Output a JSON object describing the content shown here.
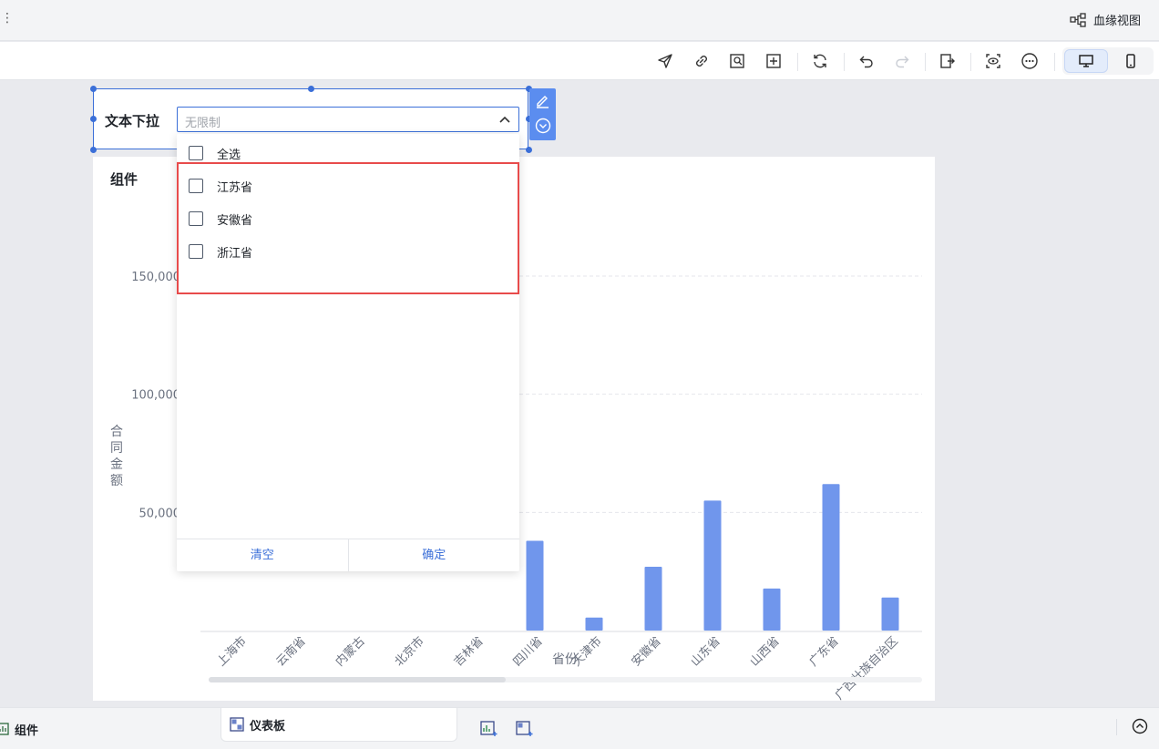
{
  "topbar": {
    "menu_glyph": "⋮",
    "lineage_label": "血缘视图"
  },
  "toolbar": {
    "icons": [
      "send-icon",
      "link-icon",
      "image-search-icon",
      "grid-plus-icon",
      "refresh-icon",
      "undo-icon",
      "redo-icon",
      "exit-icon",
      "preview-icon",
      "more-icon"
    ],
    "device": [
      "desktop-icon",
      "mobile-icon"
    ]
  },
  "filter": {
    "label": "文本下拉",
    "placeholder": "无限制",
    "options": [
      "全选",
      "江苏省",
      "安徽省",
      "浙江省"
    ],
    "clear_label": "清空",
    "confirm_label": "确定"
  },
  "chart": {
    "title": "组件",
    "y_tick_labels": [
      "150,000",
      "100,000",
      "50,000"
    ],
    "visible_bar_tick_labels": [
      "上海市",
      "云南省",
      "内蒙古",
      "北京市",
      "吉林省"
    ]
  },
  "chart_data": {
    "type": "bar",
    "title": "组件",
    "xlabel": "省份",
    "ylabel": "合同金额",
    "ylim": [
      0,
      150000
    ],
    "y_ticks": [
      0,
      50000,
      100000,
      150000
    ],
    "grid": true,
    "categories": [
      "上海市",
      "云南省",
      "内蒙古",
      "北京市",
      "吉林省",
      "四川省",
      "天津市",
      "安徽省",
      "山东省",
      "山西省",
      "广东省",
      "广西壮族自治区"
    ],
    "values": [
      null,
      null,
      null,
      null,
      null,
      38000,
      5500,
      27000,
      55000,
      17800,
      62000,
      14000
    ],
    "color": "#7096ec"
  },
  "bottombar": {
    "components_tab": "组件",
    "dashboard_tab": "仪表板"
  },
  "colors": {
    "accent": "#3b6fd8",
    "bar": "#7096ec",
    "highlight": "#e84b4b"
  }
}
